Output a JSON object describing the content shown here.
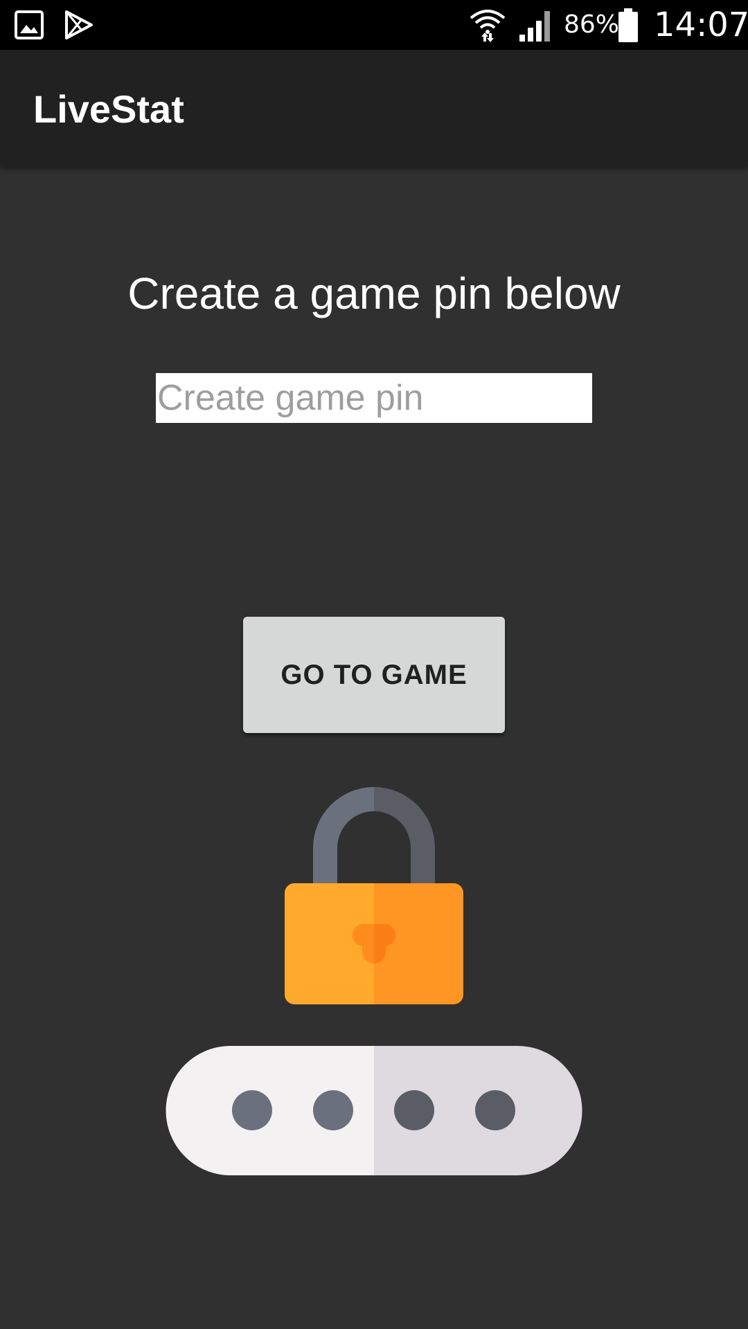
{
  "status_bar": {
    "battery_percent": "86%",
    "time": "14:07",
    "icons": [
      "gallery-icon",
      "play-store-icon",
      "wifi-icon",
      "signal-icon",
      "battery-icon"
    ]
  },
  "app_bar": {
    "title": "LiveStat"
  },
  "main": {
    "prompt": "Create a game pin below",
    "pin_input": {
      "value": "",
      "placeholder": "Create game pin"
    },
    "go_button_label": "GO TO GAME",
    "illustration": "padlock-pin-icon"
  },
  "colors": {
    "background": "#303030",
    "app_bar": "#212121",
    "status_bar": "#000000",
    "button": "#d6d7d7",
    "lock_body_light": "#FFA92D",
    "lock_body_dark": "#FF9522",
    "lock_shackle_light": "#6B707D",
    "lock_shackle_dark": "#5A5C66",
    "pin_bar_light": "#F4F1F2",
    "pin_bar_dark": "#DEDADF"
  }
}
